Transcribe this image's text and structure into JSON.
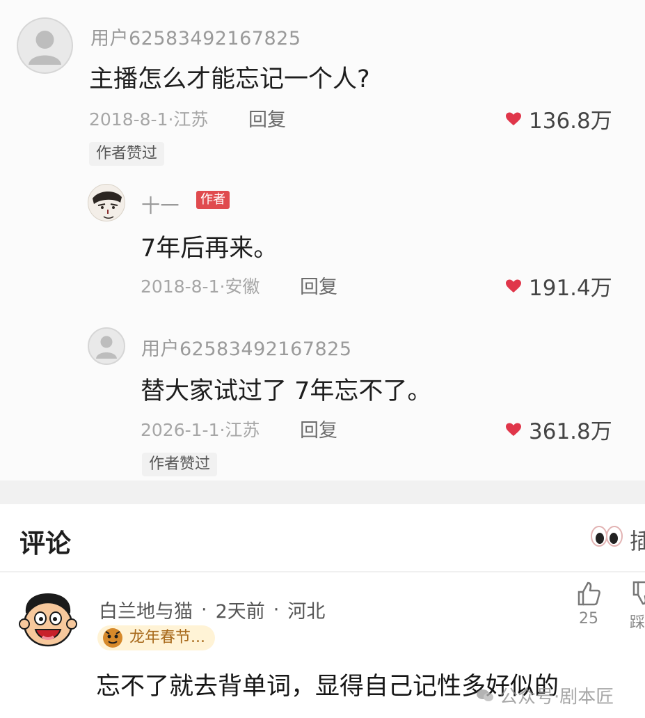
{
  "thread": {
    "comment1": {
      "username": "用户62583492167825",
      "text": "主播怎么才能忘记一个人?",
      "meta": "2018-8-1·江苏",
      "reply_label": "回复",
      "likes": "136.8万",
      "tag": "作者赞过"
    },
    "reply1": {
      "username": "十一",
      "author_badge": "作者",
      "text": "7年后再来。",
      "meta": "2018-8-1·安徽",
      "reply_label": "回复",
      "likes": "191.4万"
    },
    "reply2": {
      "username": "用户62583492167825",
      "text": "替大家试过了 7年忘不了。",
      "meta": "2026-1-1·江苏",
      "reply_label": "回复",
      "likes": "361.8万",
      "tag": "作者赞过"
    }
  },
  "comments_section": {
    "title": "评论",
    "right_label": "插",
    "item": {
      "username": "白兰地与猫",
      "time": "2天前",
      "location": "河北",
      "badge": "龙年春节...",
      "text": "忘不了就去背单词，显得自己记性多好似的",
      "like_count": "25",
      "side_label": "踩"
    },
    "watermark": "公众号·剧本匠"
  },
  "colors": {
    "heart": "#e0364a",
    "author_badge": "#e04a4e",
    "festival_badge_bg": "#fff3d6"
  }
}
